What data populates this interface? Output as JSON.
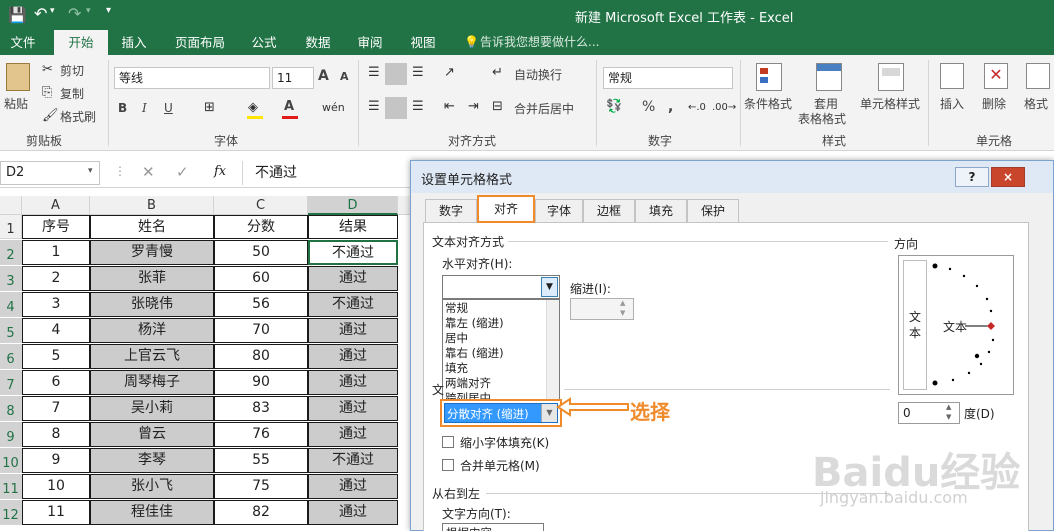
{
  "window": {
    "title": "新建 Microsoft Excel 工作表 - Excel"
  },
  "ribbon_tabs": [
    "文件",
    "开始",
    "插入",
    "页面布局",
    "公式",
    "数据",
    "审阅",
    "视图"
  ],
  "active_tab": "开始",
  "tell_me": "告诉我您想要做什么...",
  "clipboard": {
    "paste": "粘贴",
    "cut": "剪切",
    "copy": "复制",
    "format_painter": "格式刷",
    "group": "剪贴板"
  },
  "font": {
    "name": "等线",
    "size": "11",
    "group": "字体",
    "bold": "B",
    "italic": "I",
    "underline": "U",
    "grow": "A",
    "shrink": "A"
  },
  "alignment": {
    "wrap": "自动换行",
    "merge": "合并后居中",
    "group": "对齐方式"
  },
  "number": {
    "format": "常规",
    "percent": "%",
    "comma": ",",
    "group": "数字"
  },
  "styles": {
    "conditional": "条件格式",
    "table1": "套用",
    "table2": "表格格式",
    "cell_styles": "单元格样式",
    "group": "样式"
  },
  "cells": {
    "insert": "插入",
    "delete": "删除",
    "format": "格式",
    "group": "单元格"
  },
  "formula_bar": {
    "name_box": "D2",
    "fx": "fx",
    "value": "不通过"
  },
  "sheet": {
    "columns": [
      "A",
      "B",
      "C",
      "D"
    ],
    "row_numbers": [
      "1",
      "2",
      "3",
      "4",
      "5",
      "6",
      "7",
      "8",
      "9",
      "10",
      "11",
      "12"
    ],
    "headers": [
      "序号",
      "姓名",
      "分数",
      "结果"
    ],
    "rows": [
      [
        "1",
        "罗青慢",
        "50",
        "不通过"
      ],
      [
        "2",
        "张菲",
        "60",
        "通过"
      ],
      [
        "3",
        "张晓伟",
        "56",
        "不通过"
      ],
      [
        "4",
        "杨洋",
        "70",
        "通过"
      ],
      [
        "5",
        "上官云飞",
        "80",
        "通过"
      ],
      [
        "6",
        "周琴梅子",
        "90",
        "通过"
      ],
      [
        "7",
        "吴小莉",
        "83",
        "通过"
      ],
      [
        "8",
        "曾云",
        "76",
        "通过"
      ],
      [
        "9",
        "李琴",
        "55",
        "不通过"
      ],
      [
        "10",
        "张小飞",
        "75",
        "通过"
      ],
      [
        "11",
        "程佳佳",
        "82",
        "通过"
      ]
    ]
  },
  "dialog": {
    "title": "设置单元格格式",
    "help": "?",
    "close": "×",
    "tabs": [
      "数字",
      "对齐",
      "字体",
      "边框",
      "填充",
      "保护"
    ],
    "active_tab": "对齐",
    "section_text_align": "文本对齐方式",
    "horizontal_label": "水平对齐(H):",
    "indent_label": "缩进(I):",
    "horizontal_options": [
      "常规",
      "靠左 (缩进)",
      "居中",
      "靠右 (缩进)",
      "填充",
      "两端对齐",
      "跨列居中"
    ],
    "selected_option": "分散对齐 (缩进)",
    "text_control_partial": "文",
    "shrink_to_fit": "缩小字体填充(K)",
    "merge_cells": "合并单元格(M)",
    "rtl_section": "从右到左",
    "text_direction_label": "文字方向(T):",
    "text_direction_value": "根据内容",
    "orientation_label": "方向",
    "orientation_vertical": "文本",
    "orientation_text": "文本",
    "degrees_value": "0",
    "degrees_label": "度(D)"
  },
  "annotation": {
    "label": "选择",
    "color": "#f08b2c"
  },
  "watermark": {
    "brand": "Baidu经验",
    "url": "jingyan.baidu.com"
  }
}
